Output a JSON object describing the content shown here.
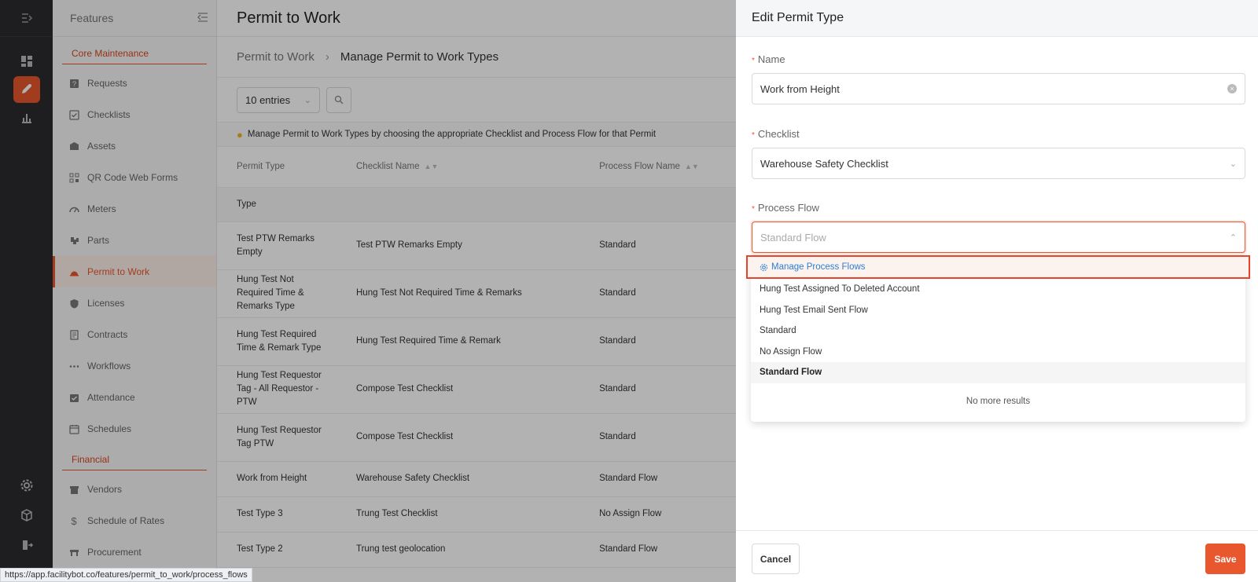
{
  "rail": {
    "items": [
      {
        "icon": "collapse-icon"
      },
      {
        "icon": "dashboard-icon"
      },
      {
        "icon": "features-icon"
      },
      {
        "icon": "analytics-icon"
      }
    ],
    "bottom": [
      {
        "icon": "gear-icon"
      },
      {
        "icon": "cube-icon"
      },
      {
        "icon": "logout-icon"
      }
    ]
  },
  "features": {
    "title": "Features",
    "sections": [
      {
        "title": "Core Maintenance",
        "items": [
          "Requests",
          "Checklists",
          "Assets",
          "QR Code Web Forms",
          "Meters",
          "Parts",
          "Permit to Work",
          "Licenses",
          "Contracts",
          "Workflows",
          "Attendance",
          "Schedules"
        ]
      },
      {
        "title": "Financial",
        "items": [
          "Vendors",
          "Schedule of Rates",
          "Procurement"
        ]
      }
    ]
  },
  "main": {
    "title": "Permit to Work",
    "breadcrumb": {
      "first": "Permit to Work",
      "second": "Manage Permit to Work Types"
    },
    "entries": "10 entries",
    "info": "Manage Permit to Work Types by choosing the appropriate Checklist and Process Flow for that Permit",
    "columns": [
      "Permit Type",
      "Checklist Name",
      "Process Flow Name"
    ],
    "type_row": "Type",
    "rows": [
      [
        "Test PTW Remarks Empty",
        "Test PTW Remarks Empty",
        "Standard"
      ],
      [
        "Hung Test Not Required Time & Remarks Type",
        "Hung Test Not Required Time & Remarks",
        "Standard"
      ],
      [
        "Hung Test Required Time & Remark Type",
        "Hung Test Required Time & Remark",
        "Standard"
      ],
      [
        "Hung Test Requestor Tag - All Requestor - PTW",
        "Compose Test Checklist",
        "Standard"
      ],
      [
        "Hung Test Requestor Tag PTW",
        "Compose Test Checklist",
        "Standard"
      ],
      [
        "Work from Height",
        "Warehouse Safety Checklist",
        "Standard Flow"
      ],
      [
        "Test Type 3",
        "Trung Test Checklist",
        "No Assign Flow"
      ],
      [
        "Test Type 2",
        "Trung test geolocation",
        "Standard Flow"
      ]
    ]
  },
  "drawer": {
    "title": "Edit Permit Type",
    "name_label": "Name",
    "name_value": "Work from Height",
    "checklist_label": "Checklist",
    "checklist_value": "Warehouse Safety Checklist",
    "flow_label": "Process Flow",
    "flow_placeholder": "Standard Flow",
    "options": {
      "manage": "Manage Process Flows",
      "list": [
        "Hung Test Assigned To Deleted Account",
        "Hung Test Email Sent Flow",
        "Standard",
        "No Assign Flow",
        "Standard Flow"
      ],
      "selected_index": 4,
      "no_more": "No more results"
    },
    "cancel": "Cancel",
    "save": "Save"
  },
  "status_url": "https://app.facilitybot.co/features/permit_to_work/process_flows",
  "colors": {
    "accent": "#e8572d",
    "link": "#2a7fd4"
  }
}
